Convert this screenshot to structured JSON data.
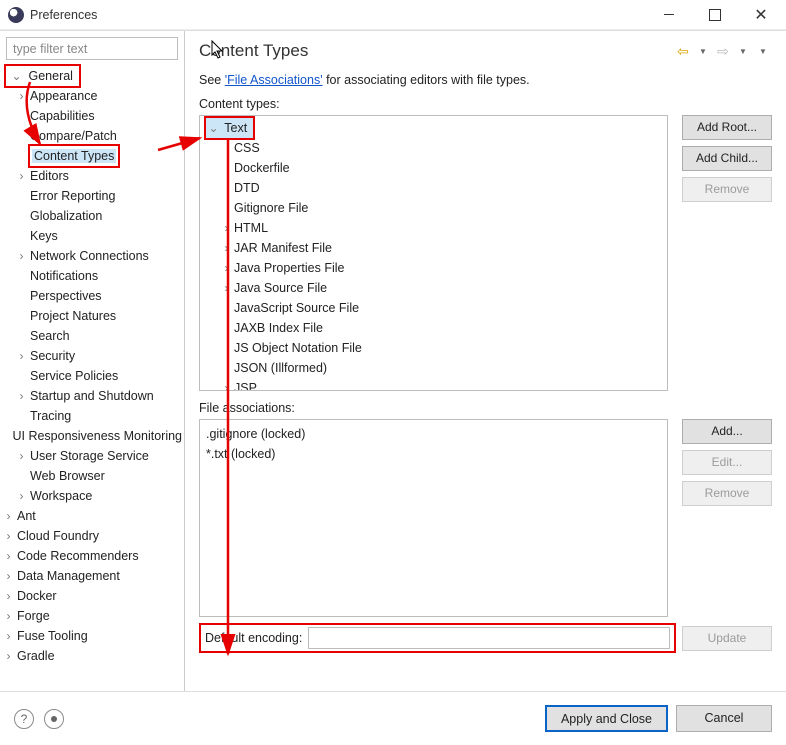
{
  "window": {
    "title": "Preferences"
  },
  "filter": {
    "placeholder": "type filter text"
  },
  "nav_tree": {
    "general": "General",
    "general_children": [
      "Appearance",
      "Capabilities",
      "Compare/Patch",
      "Content Types",
      "Editors",
      "Error Reporting",
      "Globalization",
      "Keys",
      "Network Connections",
      "Notifications",
      "Perspectives",
      "Project Natures",
      "Search",
      "Security",
      "Service Policies",
      "Startup and Shutdown",
      "Tracing",
      "UI Responsiveness Monitoring",
      "User Storage Service",
      "Web Browser",
      "Workspace"
    ],
    "general_expandable": [
      true,
      false,
      false,
      false,
      true,
      false,
      false,
      false,
      true,
      false,
      false,
      false,
      false,
      true,
      false,
      true,
      false,
      false,
      true,
      false,
      true
    ],
    "siblings": [
      "Ant",
      "Cloud Foundry",
      "Code Recommenders",
      "Data Management",
      "Docker",
      "Forge",
      "Fuse Tooling",
      "Gradle"
    ]
  },
  "page": {
    "title": "Content Types",
    "hint_pre": "See ",
    "hint_link": "'File Associations'",
    "hint_post": " for associating editors with file types.",
    "content_types_label": "Content types:",
    "text_node": "Text",
    "text_children": [
      "CSS",
      "Dockerfile",
      "DTD",
      "Gitignore File",
      "HTML",
      "JAR Manifest File",
      "Java Properties File",
      "Java Source File",
      "JavaScript Source File",
      "JAXB Index File",
      "JS Object Notation File",
      "JSON (Illformed)",
      "JSP"
    ],
    "text_children_expandable": [
      false,
      false,
      false,
      false,
      true,
      true,
      true,
      true,
      false,
      false,
      false,
      false,
      true
    ],
    "file_assoc_label": "File associations:",
    "file_assoc": [
      ".gitignore (locked)",
      "*.txt (locked)"
    ],
    "encoding_label": "Default encoding:",
    "encoding_value": ""
  },
  "buttons": {
    "add_root": "Add Root...",
    "add_child": "Add Child...",
    "remove_type": "Remove",
    "add_assoc": "Add...",
    "edit_assoc": "Edit...",
    "remove_assoc": "Remove",
    "update_enc": "Update",
    "apply_close": "Apply and Close",
    "cancel": "Cancel"
  },
  "icons": {
    "help": "?",
    "rec": "◉"
  }
}
